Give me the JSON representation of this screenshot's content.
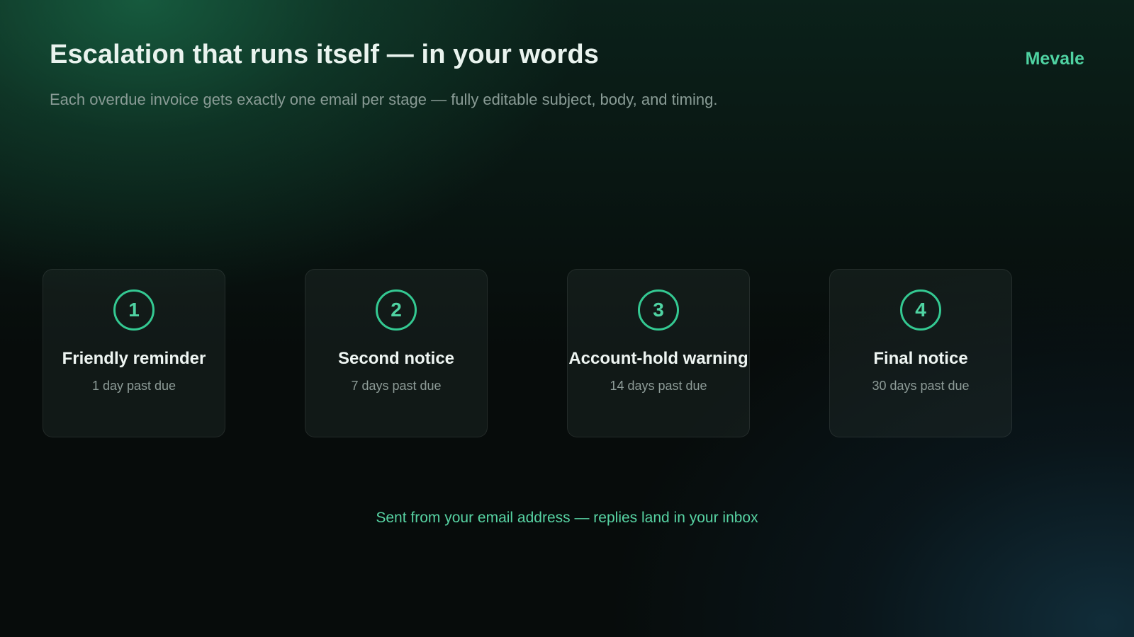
{
  "header": {
    "title": "Escalation that runs itself — in your words",
    "brand": "Mevale",
    "subtitle": "Each overdue invoice gets exactly one email per stage — fully editable subject, body, and timing."
  },
  "stages": [
    {
      "number": "1",
      "name": "Friendly reminder",
      "timing": "1 day past due"
    },
    {
      "number": "2",
      "name": "Second notice",
      "timing": "7 days past due"
    },
    {
      "number": "3",
      "name": "Account-hold warning",
      "timing": "14 days past due"
    },
    {
      "number": "4",
      "name": "Final notice",
      "timing": "30 days past due"
    }
  ],
  "footer": {
    "note": "Sent from your email address — replies land in your inbox"
  },
  "colors": {
    "accent": "#34c992",
    "background": "#070c0b",
    "title": "#e9f3ee",
    "muted": "#8a9c96"
  }
}
